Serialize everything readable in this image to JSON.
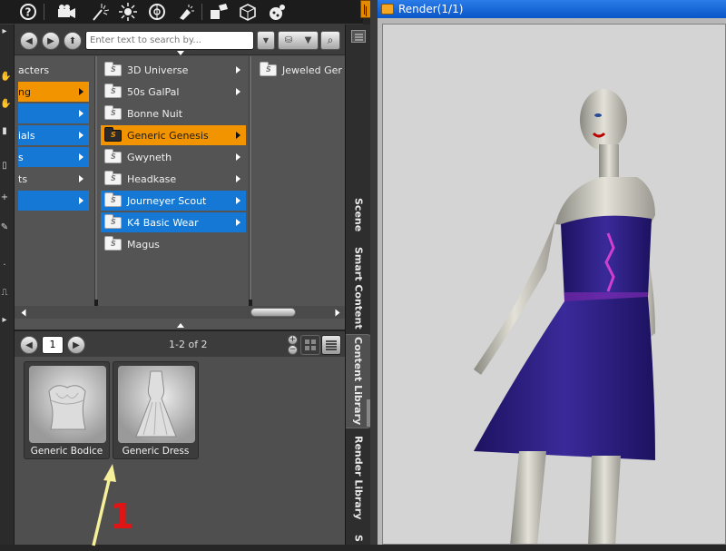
{
  "toolbar": {
    "icons": [
      "help-icon",
      "camera-icon",
      "light-icon",
      "spotlight-icon",
      "sun-icon",
      "morph-icon",
      "joint-icon",
      "node-icon",
      "hand-icon"
    ]
  },
  "search": {
    "placeholder": "Enter text to search by..."
  },
  "columns": {
    "col1": [
      {
        "label": "acters",
        "state": "normal",
        "arrow": false
      },
      {
        "label": "ng",
        "state": "orange",
        "arrow": true
      },
      {
        "label": "",
        "state": "blue",
        "arrow": true
      },
      {
        "label": "ials",
        "state": "blue",
        "arrow": true
      },
      {
        "label": "s",
        "state": "blue",
        "arrow": true
      },
      {
        "label": "ts",
        "state": "normal",
        "arrow": true
      },
      {
        "label": "",
        "state": "blue",
        "arrow": true
      }
    ],
    "col2": [
      {
        "label": "3D Universe",
        "state": "normal",
        "arrow": true
      },
      {
        "label": "50s GalPal",
        "state": "normal",
        "arrow": true
      },
      {
        "label": "Bonne Nuit",
        "state": "normal",
        "arrow": false
      },
      {
        "label": "Generic Genesis",
        "state": "orange",
        "arrow": true
      },
      {
        "label": "Gwyneth",
        "state": "normal",
        "arrow": true
      },
      {
        "label": "Headkase",
        "state": "normal",
        "arrow": true
      },
      {
        "label": "Journeyer Scout",
        "state": "blue",
        "arrow": true
      },
      {
        "label": "K4 Basic Wear",
        "state": "blue",
        "arrow": true
      },
      {
        "label": "Magus",
        "state": "normal",
        "arrow": false
      }
    ],
    "col3": [
      {
        "label": "Jeweled Ger",
        "state": "normal",
        "arrow": false
      }
    ]
  },
  "paging": {
    "page": "1",
    "count": "1-2 of 2"
  },
  "thumbnails": [
    {
      "label": "Generic Bodice"
    },
    {
      "label": "Generic Dress"
    }
  ],
  "tabs": [
    "Scene",
    "Smart Content",
    "Content Library",
    "Render Library",
    "S"
  ],
  "render": {
    "title": "Render(1/1)"
  },
  "annotation": {
    "number": "1"
  },
  "colors": {
    "highlight_orange": "#f29400",
    "highlight_blue": "#1478d4",
    "title_blue": "#0a56c8",
    "dress": "#3a2a9a"
  }
}
